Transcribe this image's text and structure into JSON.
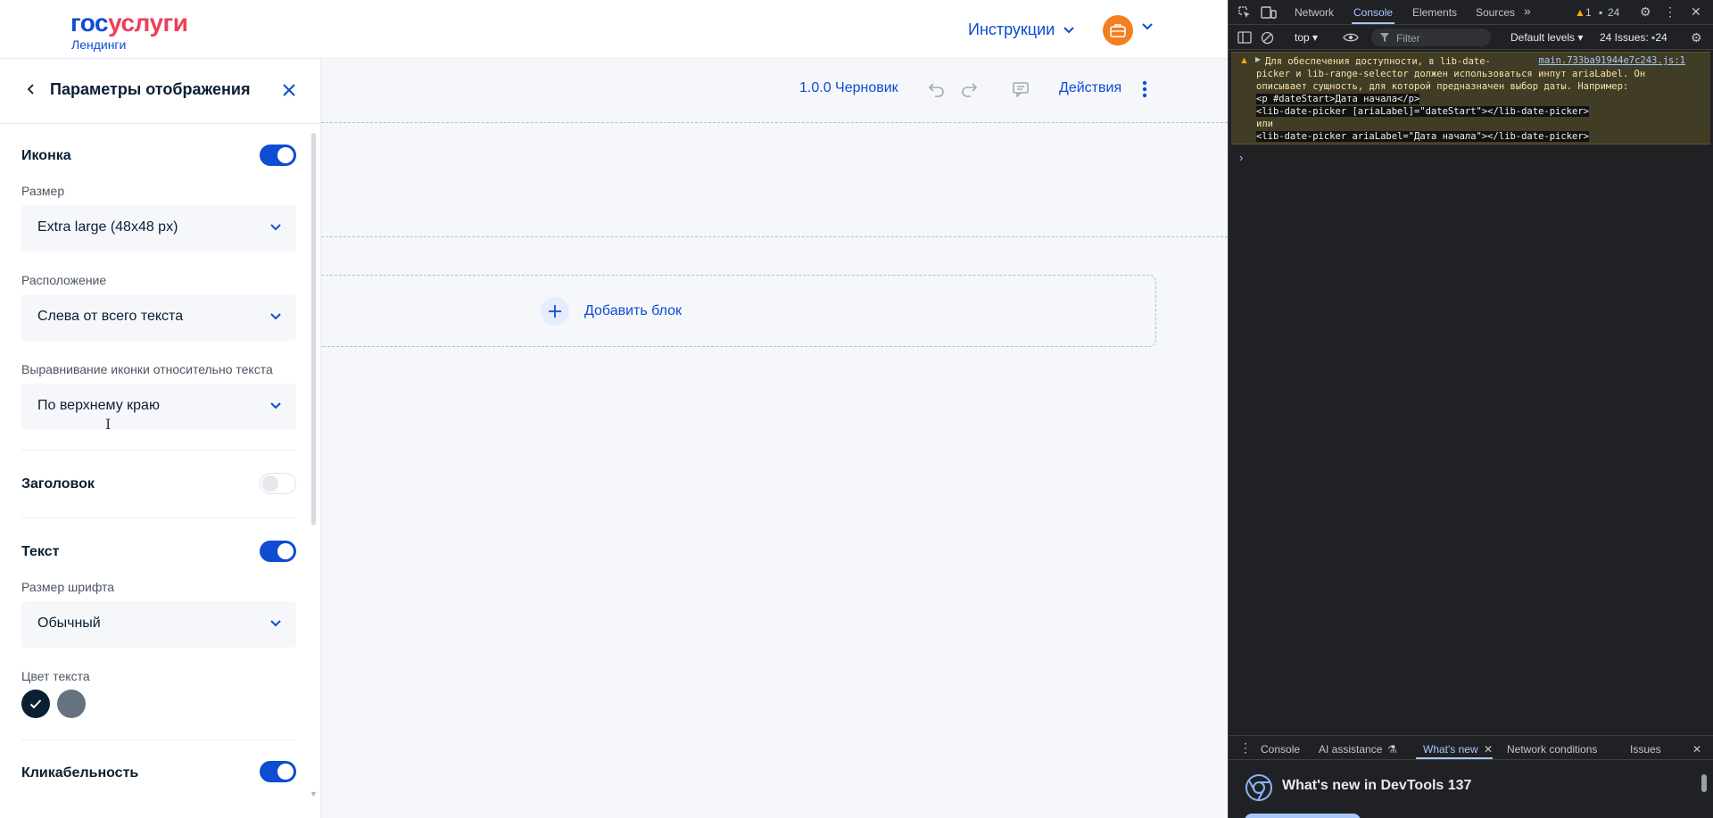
{
  "header": {
    "logo_part1": "гос",
    "logo_part2": "услуги",
    "logo_sub": "Лендинги",
    "instructions_label": "Инструкции"
  },
  "panel": {
    "title": "Параметры отображения",
    "icon_section": {
      "title": "Иконка",
      "enabled": true
    },
    "size": {
      "label": "Размер",
      "value": "Extra large (48x48 px)"
    },
    "placement": {
      "label": "Расположение",
      "value": "Слева от всего текста"
    },
    "alignment": {
      "label": "Выравнивание иконки относительно текста",
      "value": "По верхнему краю"
    },
    "heading_section": {
      "title": "Заголовок",
      "enabled": false
    },
    "text_section": {
      "title": "Текст",
      "enabled": true
    },
    "font_size": {
      "label": "Размер шрифта",
      "value": "Обычный"
    },
    "text_color": {
      "label": "Цвет текста",
      "swatches": [
        "#0b1f33",
        "#66727f"
      ],
      "selected": 0
    },
    "clickable_section": {
      "title": "Кликабельность",
      "enabled": true
    }
  },
  "canvas": {
    "version": "1.0.0 Черновик",
    "actions_label": "Действия",
    "add_block_label": "Добавить блок"
  },
  "devtools": {
    "tabs": [
      "Network",
      "Console",
      "Elements",
      "Sources"
    ],
    "active_tab": "Console",
    "warning_count": "1",
    "message_count": "24",
    "context": "top",
    "filter_placeholder": "Filter",
    "levels": "Default levels",
    "issues_label": "24 Issues:",
    "issues_count": "24",
    "warning": {
      "line1": "Для обеспечения доступности, в lib-date-",
      "line2": "picker и lib-range-selector должен использоваться инпут ariaLabel. Он",
      "line3": "описывает сущность, для которой предназначен выбор даты. Например:",
      "code1": "<p #dateStart>Дата начала</p>",
      "code2": "<lib-date-picker [ariaLabel]=\"dateStart\"></lib-date-picker>",
      "or": "или",
      "code3": "<lib-date-picker ariaLabel=\"Дата начала\"></lib-date-picker>",
      "source": "main.733ba91944e7c243.js:1"
    },
    "drawer_tabs": [
      "Console",
      "AI assistance",
      "What's new",
      "Network conditions",
      "Issues"
    ],
    "drawer_active": "What's new",
    "whats_new_title": "What's new in DevTools 137"
  },
  "colors": {
    "brand_blue": "#0d4cd3",
    "brand_red": "#ee3f58",
    "avatar": "#f47f20",
    "devtools_bg": "#202124"
  }
}
